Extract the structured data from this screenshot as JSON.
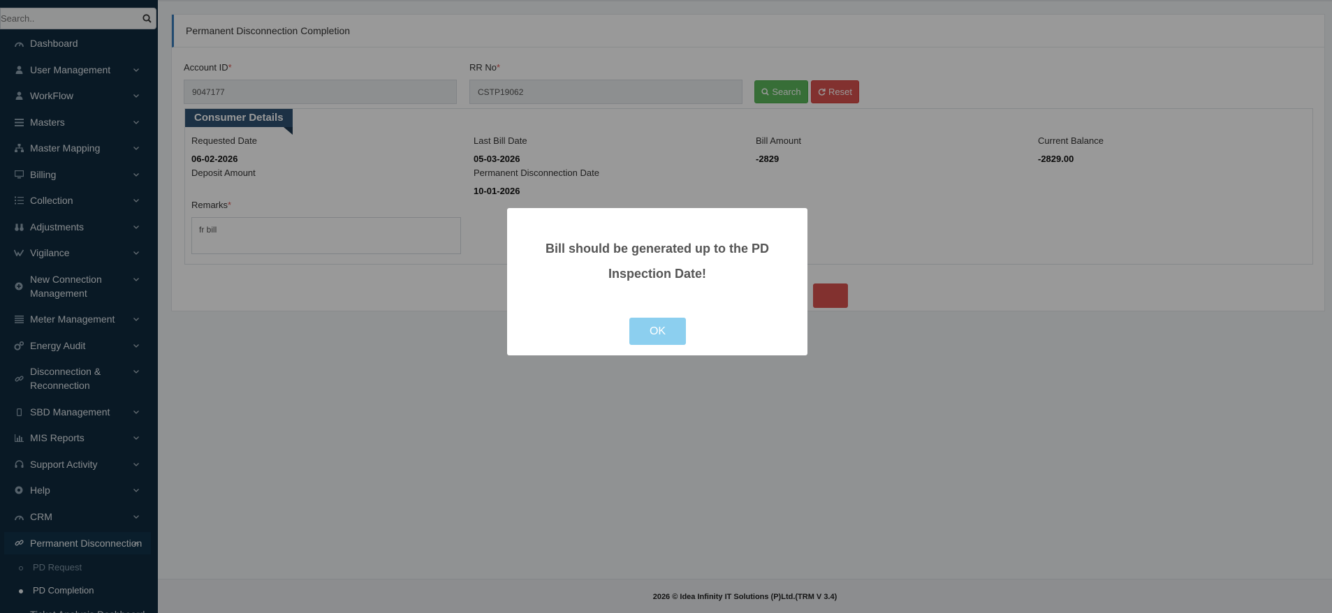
{
  "sidebar": {
    "search_placeholder": "Search..",
    "items": [
      {
        "label": "Dashboard",
        "icon": "dashboard-icon",
        "chevron": false
      },
      {
        "label": "User Management",
        "icon": "user-icon",
        "chevron": true
      },
      {
        "label": "WorkFlow",
        "icon": "user-icon",
        "chevron": true
      },
      {
        "label": "Masters",
        "icon": "list-icon",
        "chevron": true
      },
      {
        "label": "Master Mapping",
        "icon": "sitemap-icon",
        "chevron": true
      },
      {
        "label": "Billing",
        "icon": "desktop-icon",
        "chevron": true
      },
      {
        "label": "Collection",
        "icon": "list-ol-icon",
        "chevron": true
      },
      {
        "label": "Adjustments",
        "icon": "binoculars-icon",
        "chevron": true
      },
      {
        "label": "Vigilance",
        "icon": "vk-icon",
        "chevron": true
      },
      {
        "label": "New Connection Management",
        "icon": "plus-circle-icon",
        "chevron": true
      },
      {
        "label": "Meter Management",
        "icon": "list-icon",
        "chevron": true
      },
      {
        "label": "Energy Audit",
        "icon": "cogs-icon",
        "chevron": true
      },
      {
        "label": "Disconnection & Reconnection",
        "icon": "link-icon",
        "chevron": true
      },
      {
        "label": "SBD Management",
        "icon": "mobile-icon",
        "chevron": true
      },
      {
        "label": "MIS Reports",
        "icon": "bar-chart-icon",
        "chevron": true
      },
      {
        "label": "Support Activity",
        "icon": "headset-icon",
        "chevron": true
      },
      {
        "label": "Help",
        "icon": "help-icon",
        "chevron": true
      },
      {
        "label": "CRM",
        "icon": "dashboard-icon",
        "chevron": true
      },
      {
        "label": "Permanent Disconnection",
        "icon": "link-icon",
        "chevron": true
      }
    ],
    "subitems": [
      {
        "label": "PD Request"
      },
      {
        "label": "PD Completion"
      }
    ],
    "cut_item": "Ticket Analysis Dashboard"
  },
  "panel": {
    "title": "Permanent Disconnection Completion",
    "account_label": "Account ID",
    "account_value": "9047177",
    "rr_label": "RR No",
    "rr_value": "CSTP19062",
    "search_btn": "Search",
    "reset_btn": "Reset",
    "required_mark": "*"
  },
  "consumer": {
    "heading": "Consumer Details",
    "requested_date_label": "Requested Date",
    "requested_date": "06-02-2026",
    "last_bill_date_label": "Last Bill Date",
    "last_bill_date": "05-03-2026",
    "bill_amount_label": "Bill Amount",
    "bill_amount": "-2829",
    "current_balance_label": "Current Balance",
    "current_balance": "-2829.00",
    "deposit_amount_label": "Deposit Amount",
    "deposit_amount": "",
    "pd_date_label": "Permanent Disconnection Date",
    "pd_date": "10-01-2026",
    "remarks_label": "Remarks",
    "remarks_value": "fr bill"
  },
  "footer": {
    "text": "2026 © Idea Infinity IT Solutions (P)Ltd.(TRM V 3.4)"
  },
  "modal": {
    "message": "Bill should be generated up to the PD Inspection Date!",
    "ok": "OK"
  },
  "colors": {
    "sidebar_bg": "#0f2a3e",
    "accent_blue": "#3b7dbb",
    "search_green": "#5cb85c",
    "reset_red": "#d9534f",
    "ok_button": "#8ccfef"
  }
}
